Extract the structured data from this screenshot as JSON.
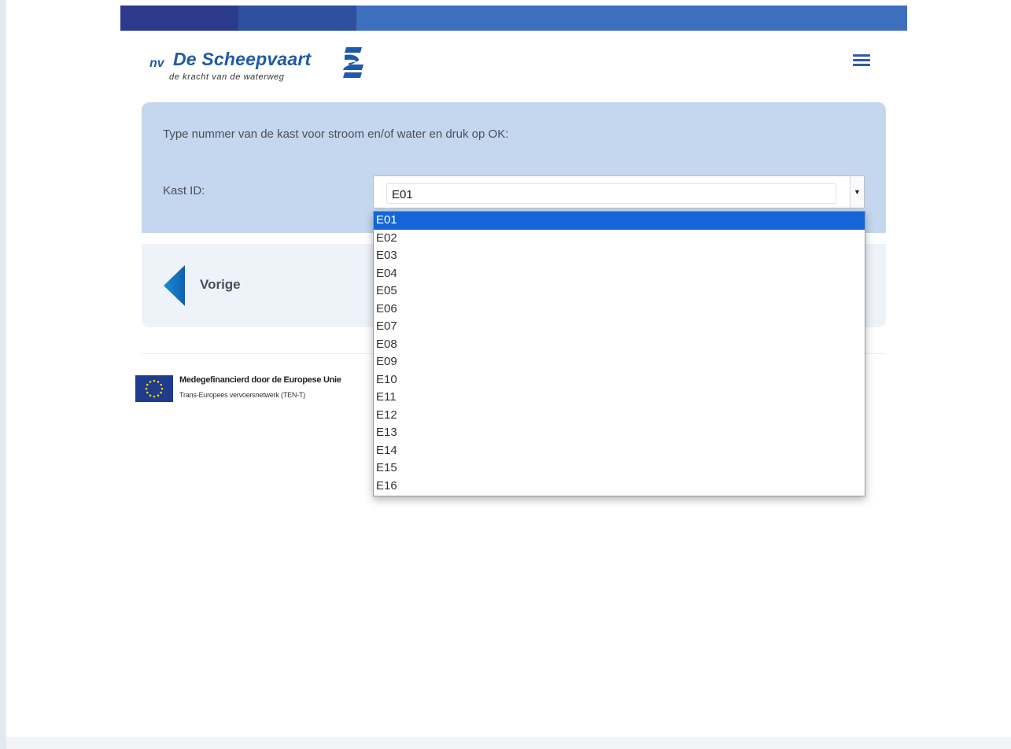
{
  "header": {
    "logo": {
      "prefix": "nv",
      "brand": "De Scheepvaart",
      "tagline": "de kracht van de waterweg"
    },
    "menu_icon": "hamburger-icon"
  },
  "form": {
    "instruction": "Type nummer van de kast voor stroom en/of water en druk op OK:",
    "kast_label": "Kast ID:",
    "selected_value": "E01",
    "options": [
      "E01",
      "E02",
      "E03",
      "E04",
      "E05",
      "E06",
      "E07",
      "E08",
      "E09",
      "E10",
      "E11",
      "E12",
      "E13",
      "E14",
      "E15",
      "E16"
    ]
  },
  "navigation": {
    "previous_label": "Vorige"
  },
  "footer": {
    "eu_line1": "Medegefinancierd door de Europese Unie",
    "eu_line2": "Trans-Europees vervoersnetwerk (TEN-T)"
  },
  "colors": {
    "brand_blue": "#1f5aa8",
    "panel_blue": "#c5d7ee",
    "selected_option": "#1565d8"
  }
}
